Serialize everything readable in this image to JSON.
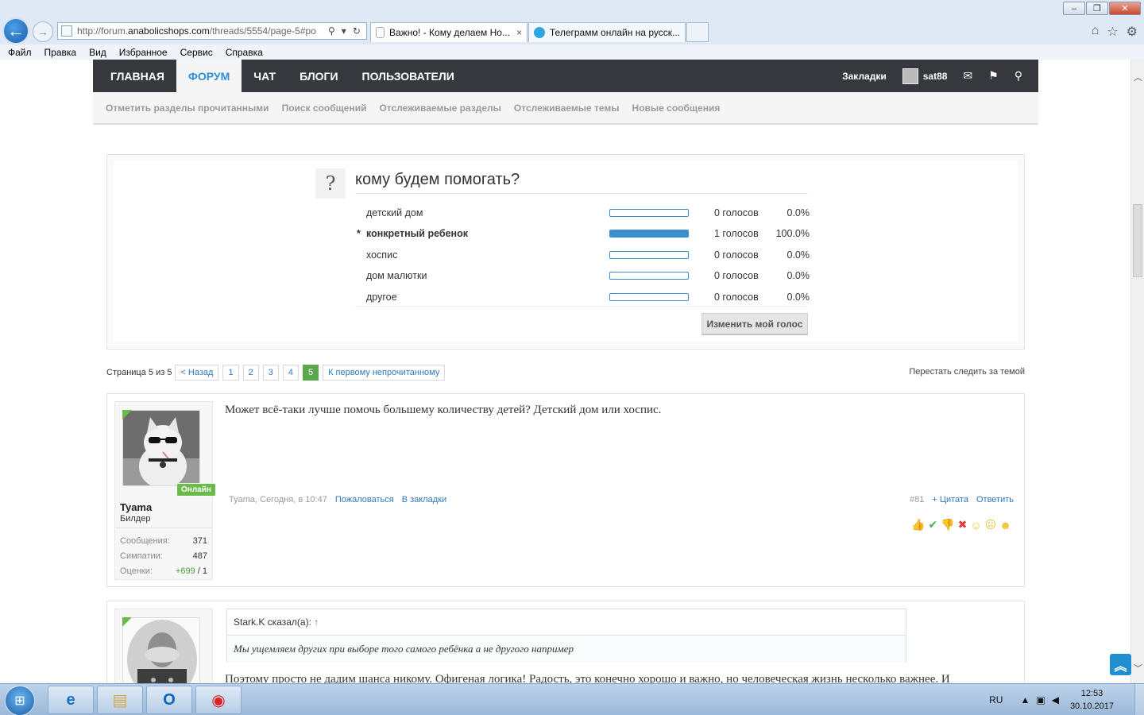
{
  "browser": {
    "url_prefix": "http://forum.",
    "url_host": "anabolicshops.com",
    "url_path": "/threads/5554/page-5#po",
    "tabs": [
      {
        "label": "Важно! - Кому делаем Но...",
        "close": "×"
      },
      {
        "label": "Телеграмм онлайн на русск..."
      }
    ],
    "menu": [
      "Файл",
      "Правка",
      "Вид",
      "Избранное",
      "Сервис",
      "Справка"
    ]
  },
  "site": {
    "nav": [
      "ГЛАВНАЯ",
      "ФОРУМ",
      "ЧАТ",
      "БЛОГИ",
      "ПОЛЬЗОВАТЕЛИ"
    ],
    "bookmarks": "Закладки",
    "username": "sat88",
    "subnav": [
      "Отметить разделы прочитанными",
      "Поиск сообщений",
      "Отслеживаемые разделы",
      "Отслеживаемые темы",
      "Новые сообщения"
    ]
  },
  "poll": {
    "q_icon": "?",
    "title": "кому будем помогать?",
    "options": [
      {
        "label": "детский дом",
        "votes": "0 голосов",
        "pct": "0.0%",
        "share": 0,
        "mine": ""
      },
      {
        "label": "конкретный ребенок",
        "votes": "1 голосов",
        "pct": "100.0%",
        "share": 1,
        "mine": "*"
      },
      {
        "label": "хоспис",
        "votes": "0 голосов",
        "pct": "0.0%",
        "share": 0,
        "mine": ""
      },
      {
        "label": "дом малютки",
        "votes": "0 голосов",
        "pct": "0.0%",
        "share": 0,
        "mine": ""
      },
      {
        "label": "другое",
        "votes": "0 голосов",
        "pct": "0.0%",
        "share": 0,
        "mine": ""
      }
    ],
    "button": "Изменить мой голос"
  },
  "pagination": {
    "label": "Страница 5 из 5",
    "prev": "< Назад",
    "pages": [
      "1",
      "2",
      "3",
      "4",
      "5"
    ],
    "current": "5",
    "first_unread": "К первому непрочитанному",
    "unwatch": "Перестать следить за темой"
  },
  "post1": {
    "online": "Онлайн",
    "username": "Tyama",
    "title": "Билдер",
    "stats": [
      {
        "label": "Сообщения:",
        "value": "371"
      },
      {
        "label": "Симпатии:",
        "value": "487"
      }
    ],
    "rating_label": "Оценки:",
    "rating_pos": "+699",
    "rating_rest": " / 1",
    "text": "Может всё-таки лучше помочь большему количеству детей? Детский дом или хоспис.",
    "meta": "Tyama, Сегодня, в 10:47",
    "report": "Пожаловаться",
    "bookmark": "В закладки",
    "number": "#81",
    "quote": "+ Цитата",
    "reply": "Ответить"
  },
  "post2": {
    "quote_author": "Stark.K сказал(а):",
    "quote_arrow": "↑",
    "quote_text": "Мы ущемляем других при выборе того самого ребёнка а не другого например",
    "text": "Поэтому просто не дадим шанса никому. Офигеная логика! Радость, это конечно хорошо и важно, но человеческая жизнь несколько важнее. И"
  },
  "taskbar": {
    "lang": "RU",
    "time": "12:53",
    "date": "30.10.2017"
  },
  "colors": {
    "nav_bg": "#36383d",
    "accent_blue": "#2f8ed4",
    "online_green": "#6bbb4c"
  }
}
